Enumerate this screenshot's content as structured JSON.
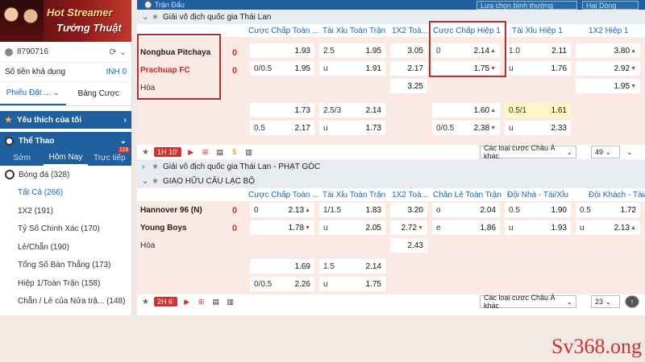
{
  "sidebar": {
    "banner_line1": "Hot Streamer",
    "banner_line2": "Tướng Thuật",
    "account_id": "8790716",
    "balance_label": "Số tiền khả dụng",
    "balance_value": "INH 0",
    "tab_bet_slip": "Phiếu Đặt ...",
    "tab_bet_list": "Bảng Cược",
    "favorites": "Yêu thích của tôi",
    "sports": "Thể Thao",
    "subtabs": [
      "Sớm",
      "Hôm Nay",
      "Trực tiếp"
    ],
    "live_count": "119",
    "football": "Bóng đá",
    "football_count": "(328)",
    "items": [
      {
        "label": "Tất Cả",
        "count": "(266)"
      },
      {
        "label": "1X2",
        "count": "(191)"
      },
      {
        "label": "Tỷ Số Chính Xác",
        "count": "(170)"
      },
      {
        "label": "Lẻ/Chẵn",
        "count": "(190)"
      },
      {
        "label": "Tổng Số Bàn Thắng",
        "count": "(173)"
      },
      {
        "label": "Hiệp 1/Toàn Trận",
        "count": "(158)"
      },
      {
        "label": "Chẵn / Lẻ của Nửa trậ...",
        "count": "(148)"
      }
    ]
  },
  "topbar": {
    "title": "Trận Đấu",
    "sort": "Lựa chọn bình thường",
    "odds_type": "Hai Dòng"
  },
  "league1": {
    "name": "Giải vô địch quốc gia Thái Lan",
    "headers": [
      "Cược Chấp Toàn ...",
      "Tài Xỉu Toàn Trận",
      "1X2 Toà...",
      "Cược Chấp Hiệp 1",
      "Tài Xỉu Hiệp 1",
      "1X2 Hiệp 1"
    ],
    "home": "Nongbua Pitchaya",
    "away": "Prachuap FC",
    "draw": "Hòa",
    "home_score": "0",
    "away_score": "0",
    "row1": [
      [
        "",
        "1.93"
      ],
      [
        "2.5",
        "1.95"
      ],
      [
        "",
        "3.05"
      ],
      [
        "0",
        "2.14"
      ],
      [
        "1.0",
        "2.11"
      ],
      [
        "",
        "3.80"
      ]
    ],
    "row2": [
      [
        "0/0.5",
        "1.95"
      ],
      [
        "u",
        "1.91"
      ],
      [
        "",
        "2.17"
      ],
      [
        "",
        "1.75"
      ],
      [
        "u",
        "1.76"
      ],
      [
        "",
        "2.92"
      ]
    ],
    "row3": [
      [
        "",
        "3.25"
      ],
      [
        "",
        "1.95"
      ]
    ],
    "row4": [
      [
        "",
        "1.73"
      ],
      [
        "2.5/3",
        "2.14"
      ],
      [
        "",
        "1.60"
      ],
      [
        "0.5/1",
        "1.61"
      ]
    ],
    "row5": [
      [
        "0.5",
        "2.17"
      ],
      [
        "u",
        "1.73"
      ],
      [
        "0/0.5",
        "2.38"
      ],
      [
        "u",
        "2.33"
      ]
    ],
    "live_time": "1H 10'",
    "more_bets": "Các loại cược Châu Á khác",
    "more_count": "49"
  },
  "league2": {
    "name": "Giải vô địch quốc gia Thái Lan - PHẠT GÓC"
  },
  "league3": {
    "name": "GIAO HỮU CÂU LẠC BỘ",
    "headers": [
      "Cược Chấp Toàn ...",
      "Tài Xỉu Toàn Trận",
      "1X2 Toà...",
      "Chẵn Lẻ Toàn Trận",
      "Đội Nhà - Tài/Xỉu",
      "Đội Khách - Tài/..."
    ],
    "home": "Hannover 96 (N)",
    "away": "Young Boys",
    "draw": "Hòa",
    "home_score": "0",
    "away_score": "0",
    "row1": [
      [
        "0",
        "2.13"
      ],
      [
        "1/1.5",
        "1.83"
      ],
      [
        "",
        "3.20"
      ],
      [
        "o",
        "2.04"
      ],
      [
        "0.5",
        "1.90"
      ],
      [
        "0.5",
        "1.72"
      ]
    ],
    "row2": [
      [
        "",
        "1.78"
      ],
      [
        "u",
        "2.05"
      ],
      [
        "",
        "2.72"
      ],
      [
        "e",
        "1.86"
      ],
      [
        "u",
        "1.93"
      ],
      [
        "u",
        "2.13"
      ]
    ],
    "row3": [
      [
        "",
        "2.43"
      ]
    ],
    "row4": [
      [
        "",
        "1.69"
      ],
      [
        "1.5",
        "2.14"
      ]
    ],
    "row5": [
      [
        "0/0.5",
        "2.26"
      ],
      [
        "u",
        "1.75"
      ]
    ],
    "live_time": "2H 6'",
    "more_bets": "Các loại cược Châu Á khác",
    "more_count": "23"
  },
  "watermark": "Sv368.ong"
}
